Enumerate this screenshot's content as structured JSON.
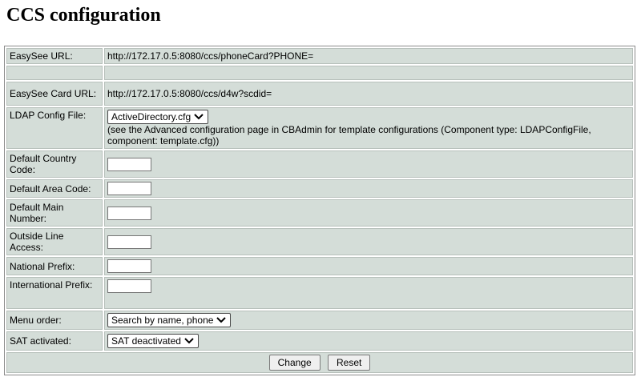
{
  "page": {
    "title": "CCS configuration"
  },
  "rows": {
    "easysee_url": {
      "label": "EasySee URL:",
      "value": "http://172.17.0.5:8080/ccs/phoneCard?PHONE="
    },
    "easysee_card_url": {
      "label": "EasySee Card URL:",
      "value": "http://172.17.0.5:8080/ccs/d4w?scdid="
    },
    "ldap_config": {
      "label": "LDAP Config File:",
      "selected": "ActiveDirectory.cfg",
      "note": "(see the Advanced configuration page in CBAdmin for template configurations (Component type: LDAPConfigFile, component: template.cfg))"
    },
    "default_country_code": {
      "label": "Default Country Code:",
      "value": ""
    },
    "default_area_code": {
      "label": "Default Area Code:",
      "value": ""
    },
    "default_main_number": {
      "label": "Default Main Number:",
      "value": ""
    },
    "outside_line_access": {
      "label": "Outside Line Access:",
      "value": ""
    },
    "national_prefix": {
      "label": "National Prefix:",
      "value": ""
    },
    "international_prefix": {
      "label": "International Prefix:",
      "value": ""
    },
    "menu_order": {
      "label": "Menu order:",
      "selected": "Search by name, phone"
    },
    "sat_activated": {
      "label": "SAT activated:",
      "selected": "SAT deactivated"
    }
  },
  "buttons": {
    "change": "Change",
    "reset": "Reset"
  },
  "icons": {
    "dropdown": "chevron-down-icon"
  }
}
